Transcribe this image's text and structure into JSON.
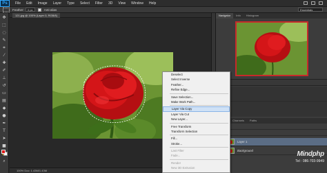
{
  "menubar": {
    "logo": "Ps",
    "items": [
      "File",
      "Edit",
      "Image",
      "Layer",
      "Type",
      "Select",
      "Filter",
      "3D",
      "View",
      "Window",
      "Help"
    ]
  },
  "options": {
    "feather_label": "Feather:",
    "feather_value": "0 px",
    "antialias_label": "Anti-alias",
    "workspace": "Essentials"
  },
  "document": {
    "tab_title": "121.jpg @ 100% (Layer 0, RGB/8)",
    "status": "100%    Doc: 1.43M/1.43M"
  },
  "context_menu": {
    "items": [
      {
        "label": "Deselect",
        "enabled": true
      },
      {
        "label": "Select Inverse",
        "enabled": true
      },
      {
        "label": "Feather...",
        "enabled": true
      },
      {
        "label": "Refine Edge...",
        "enabled": true
      },
      {
        "sep": true
      },
      {
        "label": "Save Selection...",
        "enabled": true
      },
      {
        "label": "Make Work Path...",
        "enabled": true
      },
      {
        "sep": true
      },
      {
        "label": "Layer Via Copy",
        "enabled": true,
        "highlight": true
      },
      {
        "label": "Layer Via Cut",
        "enabled": true
      },
      {
        "label": "New Layer...",
        "enabled": true
      },
      {
        "sep": true
      },
      {
        "label": "Free Transform",
        "enabled": true
      },
      {
        "label": "Transform Selection",
        "enabled": true
      },
      {
        "sep": true
      },
      {
        "label": "Fill...",
        "enabled": true
      },
      {
        "label": "Stroke...",
        "enabled": true
      },
      {
        "sep": true
      },
      {
        "label": "Last Filter",
        "enabled": false
      },
      {
        "label": "Fade...",
        "enabled": false
      },
      {
        "sep": true
      },
      {
        "label": "Render",
        "enabled": false
      },
      {
        "label": "New 3D Extrusion",
        "enabled": false
      }
    ]
  },
  "right_panel": {
    "nav_tabs": [
      "Navigator",
      "Info",
      "Histogram"
    ],
    "styles_label": "Styles",
    "layer_tabs": [
      "Layers",
      "Channels",
      "Paths"
    ],
    "layers": [
      {
        "name": "Layer 1"
      },
      {
        "name": "Background"
      }
    ]
  },
  "watermark": {
    "brand": "Mindphp",
    "phone": "Tel : 086-703-9949"
  },
  "colors": {
    "foreground": "#e01818",
    "background": "#ffffff",
    "panel_bg": "#3c3c3c",
    "app_bg": "#282828"
  }
}
